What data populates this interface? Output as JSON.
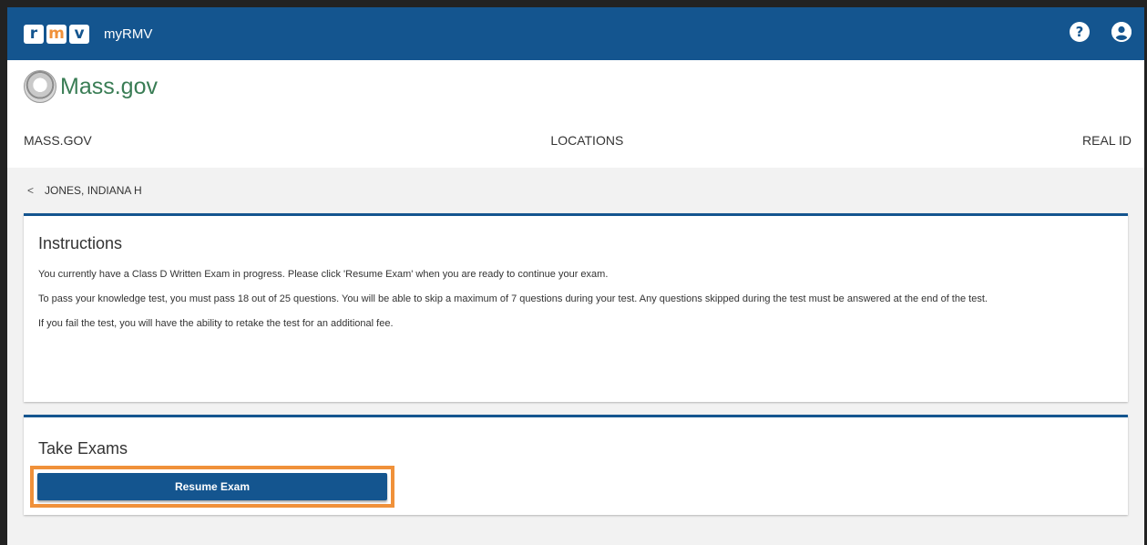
{
  "appbar": {
    "logo_letters": [
      "r",
      "m",
      "v"
    ],
    "logo_colors": [
      "#14558f",
      "#f0913a",
      "#14558f"
    ],
    "title": "myRMV",
    "help_icon": "question-circle-icon",
    "help_glyph": "?",
    "account_icon": "user-circle-icon",
    "account_glyph": "●"
  },
  "massgov": {
    "seal_icon": "massachusetts-seal-icon",
    "text": "Mass.gov"
  },
  "nav": {
    "items": [
      "MASS.GOV",
      "LOCATIONS",
      "REAL ID"
    ]
  },
  "breadcrumb": {
    "back_glyph": "<",
    "label": "JONES, INDIANA H"
  },
  "instructions": {
    "title": "Instructions",
    "paragraphs": [
      "You currently have a Class D Written Exam in progress. Please click 'Resume Exam' when you are ready to continue your exam.",
      "To pass your knowledge test, you must pass 18 out of 25 questions. You will be able to skip a maximum of 7 questions during your test. Any questions skipped during the test must be answered at the end of the test.",
      "If you fail the test, you will have the ability to retake the test for an additional fee."
    ]
  },
  "exams": {
    "title": "Take Exams",
    "button_label": "Resume Exam"
  },
  "colors": {
    "brand_blue": "#14558f",
    "highlight_orange": "#f0913a",
    "massgov_green": "#3a7d55"
  }
}
